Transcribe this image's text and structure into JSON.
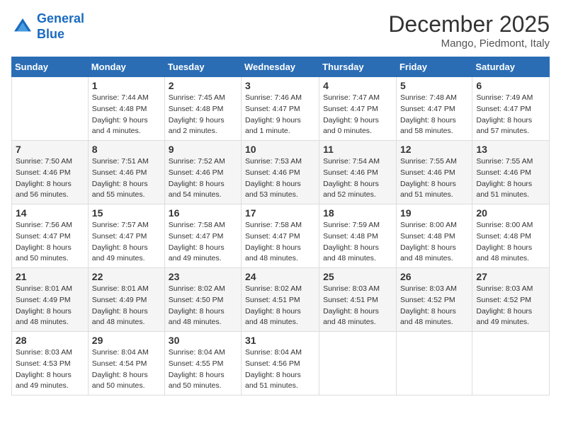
{
  "header": {
    "logo_line1": "General",
    "logo_line2": "Blue",
    "month": "December 2025",
    "location": "Mango, Piedmont, Italy"
  },
  "days_of_week": [
    "Sunday",
    "Monday",
    "Tuesday",
    "Wednesday",
    "Thursday",
    "Friday",
    "Saturday"
  ],
  "weeks": [
    [
      {
        "day": "",
        "sunrise": "",
        "sunset": "",
        "daylight": ""
      },
      {
        "day": "1",
        "sunrise": "Sunrise: 7:44 AM",
        "sunset": "Sunset: 4:48 PM",
        "daylight": "Daylight: 9 hours and 4 minutes."
      },
      {
        "day": "2",
        "sunrise": "Sunrise: 7:45 AM",
        "sunset": "Sunset: 4:48 PM",
        "daylight": "Daylight: 9 hours and 2 minutes."
      },
      {
        "day": "3",
        "sunrise": "Sunrise: 7:46 AM",
        "sunset": "Sunset: 4:47 PM",
        "daylight": "Daylight: 9 hours and 1 minute."
      },
      {
        "day": "4",
        "sunrise": "Sunrise: 7:47 AM",
        "sunset": "Sunset: 4:47 PM",
        "daylight": "Daylight: 9 hours and 0 minutes."
      },
      {
        "day": "5",
        "sunrise": "Sunrise: 7:48 AM",
        "sunset": "Sunset: 4:47 PM",
        "daylight": "Daylight: 8 hours and 58 minutes."
      },
      {
        "day": "6",
        "sunrise": "Sunrise: 7:49 AM",
        "sunset": "Sunset: 4:47 PM",
        "daylight": "Daylight: 8 hours and 57 minutes."
      }
    ],
    [
      {
        "day": "7",
        "sunrise": "Sunrise: 7:50 AM",
        "sunset": "Sunset: 4:46 PM",
        "daylight": "Daylight: 8 hours and 56 minutes."
      },
      {
        "day": "8",
        "sunrise": "Sunrise: 7:51 AM",
        "sunset": "Sunset: 4:46 PM",
        "daylight": "Daylight: 8 hours and 55 minutes."
      },
      {
        "day": "9",
        "sunrise": "Sunrise: 7:52 AM",
        "sunset": "Sunset: 4:46 PM",
        "daylight": "Daylight: 8 hours and 54 minutes."
      },
      {
        "day": "10",
        "sunrise": "Sunrise: 7:53 AM",
        "sunset": "Sunset: 4:46 PM",
        "daylight": "Daylight: 8 hours and 53 minutes."
      },
      {
        "day": "11",
        "sunrise": "Sunrise: 7:54 AM",
        "sunset": "Sunset: 4:46 PM",
        "daylight": "Daylight: 8 hours and 52 minutes."
      },
      {
        "day": "12",
        "sunrise": "Sunrise: 7:55 AM",
        "sunset": "Sunset: 4:46 PM",
        "daylight": "Daylight: 8 hours and 51 minutes."
      },
      {
        "day": "13",
        "sunrise": "Sunrise: 7:55 AM",
        "sunset": "Sunset: 4:46 PM",
        "daylight": "Daylight: 8 hours and 51 minutes."
      }
    ],
    [
      {
        "day": "14",
        "sunrise": "Sunrise: 7:56 AM",
        "sunset": "Sunset: 4:47 PM",
        "daylight": "Daylight: 8 hours and 50 minutes."
      },
      {
        "day": "15",
        "sunrise": "Sunrise: 7:57 AM",
        "sunset": "Sunset: 4:47 PM",
        "daylight": "Daylight: 8 hours and 49 minutes."
      },
      {
        "day": "16",
        "sunrise": "Sunrise: 7:58 AM",
        "sunset": "Sunset: 4:47 PM",
        "daylight": "Daylight: 8 hours and 49 minutes."
      },
      {
        "day": "17",
        "sunrise": "Sunrise: 7:58 AM",
        "sunset": "Sunset: 4:47 PM",
        "daylight": "Daylight: 8 hours and 48 minutes."
      },
      {
        "day": "18",
        "sunrise": "Sunrise: 7:59 AM",
        "sunset": "Sunset: 4:48 PM",
        "daylight": "Daylight: 8 hours and 48 minutes."
      },
      {
        "day": "19",
        "sunrise": "Sunrise: 8:00 AM",
        "sunset": "Sunset: 4:48 PM",
        "daylight": "Daylight: 8 hours and 48 minutes."
      },
      {
        "day": "20",
        "sunrise": "Sunrise: 8:00 AM",
        "sunset": "Sunset: 4:48 PM",
        "daylight": "Daylight: 8 hours and 48 minutes."
      }
    ],
    [
      {
        "day": "21",
        "sunrise": "Sunrise: 8:01 AM",
        "sunset": "Sunset: 4:49 PM",
        "daylight": "Daylight: 8 hours and 48 minutes."
      },
      {
        "day": "22",
        "sunrise": "Sunrise: 8:01 AM",
        "sunset": "Sunset: 4:49 PM",
        "daylight": "Daylight: 8 hours and 48 minutes."
      },
      {
        "day": "23",
        "sunrise": "Sunrise: 8:02 AM",
        "sunset": "Sunset: 4:50 PM",
        "daylight": "Daylight: 8 hours and 48 minutes."
      },
      {
        "day": "24",
        "sunrise": "Sunrise: 8:02 AM",
        "sunset": "Sunset: 4:51 PM",
        "daylight": "Daylight: 8 hours and 48 minutes."
      },
      {
        "day": "25",
        "sunrise": "Sunrise: 8:03 AM",
        "sunset": "Sunset: 4:51 PM",
        "daylight": "Daylight: 8 hours and 48 minutes."
      },
      {
        "day": "26",
        "sunrise": "Sunrise: 8:03 AM",
        "sunset": "Sunset: 4:52 PM",
        "daylight": "Daylight: 8 hours and 48 minutes."
      },
      {
        "day": "27",
        "sunrise": "Sunrise: 8:03 AM",
        "sunset": "Sunset: 4:52 PM",
        "daylight": "Daylight: 8 hours and 49 minutes."
      }
    ],
    [
      {
        "day": "28",
        "sunrise": "Sunrise: 8:03 AM",
        "sunset": "Sunset: 4:53 PM",
        "daylight": "Daylight: 8 hours and 49 minutes."
      },
      {
        "day": "29",
        "sunrise": "Sunrise: 8:04 AM",
        "sunset": "Sunset: 4:54 PM",
        "daylight": "Daylight: 8 hours and 50 minutes."
      },
      {
        "day": "30",
        "sunrise": "Sunrise: 8:04 AM",
        "sunset": "Sunset: 4:55 PM",
        "daylight": "Daylight: 8 hours and 50 minutes."
      },
      {
        "day": "31",
        "sunrise": "Sunrise: 8:04 AM",
        "sunset": "Sunset: 4:56 PM",
        "daylight": "Daylight: 8 hours and 51 minutes."
      },
      {
        "day": "",
        "sunrise": "",
        "sunset": "",
        "daylight": ""
      },
      {
        "day": "",
        "sunrise": "",
        "sunset": "",
        "daylight": ""
      },
      {
        "day": "",
        "sunrise": "",
        "sunset": "",
        "daylight": ""
      }
    ]
  ]
}
